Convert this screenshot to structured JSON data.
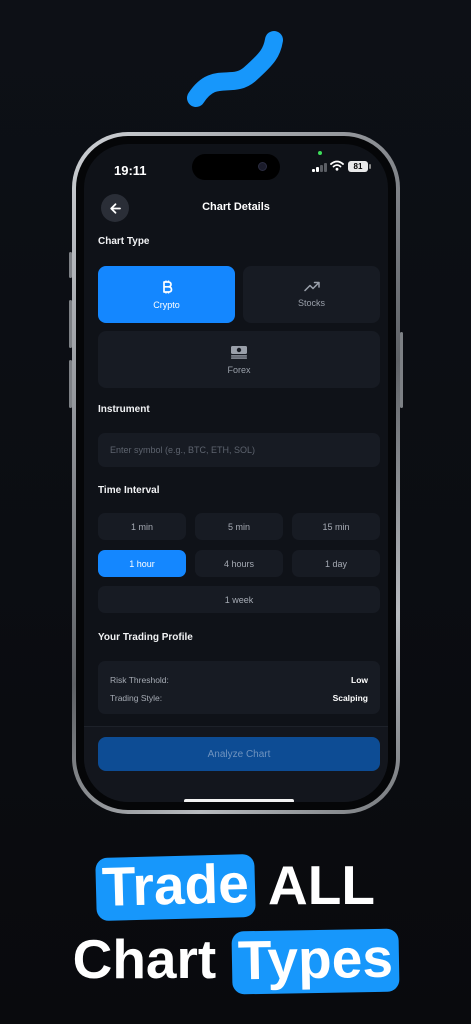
{
  "colors": {
    "accent": "#1487ff",
    "highlight": "#1797fb",
    "background": "#0b0d12"
  },
  "status_bar": {
    "time": "19:11",
    "battery": "81"
  },
  "header": {
    "title": "Chart Details",
    "back_icon": "arrow-left-icon"
  },
  "chart_type": {
    "label": "Chart Type",
    "options": [
      {
        "label": "Crypto",
        "icon": "bitcoin-icon",
        "selected": true
      },
      {
        "label": "Stocks",
        "icon": "trending-up-icon",
        "selected": false
      },
      {
        "label": "Forex",
        "icon": "money-icon",
        "selected": false
      }
    ]
  },
  "instrument": {
    "label": "Instrument",
    "placeholder": "Enter symbol (e.g., BTC, ETH, SOL)",
    "value": ""
  },
  "time_interval": {
    "label": "Time Interval",
    "options": [
      "1 min",
      "5 min",
      "15 min",
      "1 hour",
      "4 hours",
      "1 day",
      "1 week"
    ],
    "selected": "1 hour"
  },
  "profile": {
    "label": "Your Trading Profile",
    "rows": [
      {
        "key": "Risk Threshold:",
        "value": "Low"
      },
      {
        "key": "Trading Style:",
        "value": "Scalping"
      }
    ]
  },
  "analyze_button": {
    "label": "Analyze Chart"
  },
  "tagline": {
    "line1_highlight": "Trade",
    "line1_rest": "ALL",
    "line2_plain": "Chart",
    "line2_highlight": "Types"
  }
}
